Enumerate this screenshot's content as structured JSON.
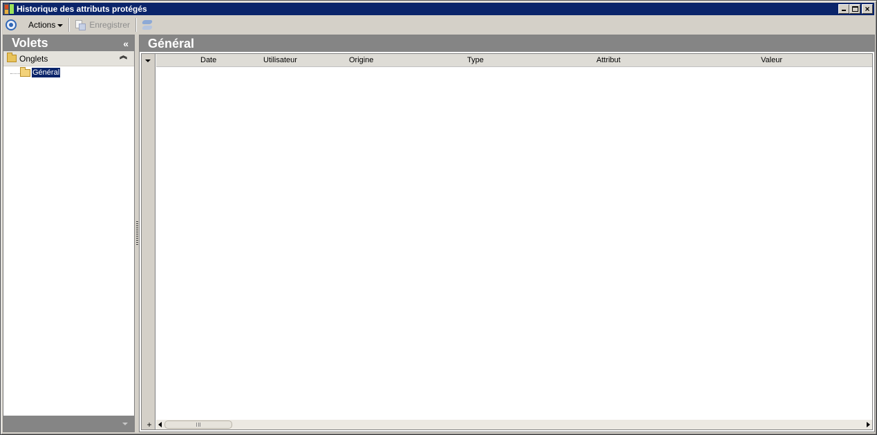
{
  "window": {
    "title": "Historique des attributs protégés"
  },
  "toolbar": {
    "actions_label": "Actions",
    "save_label": "Enregistrer"
  },
  "left_panel": {
    "title": "Volets",
    "collapse_glyph": "«",
    "group": {
      "label": "Onglets",
      "collapse_glyph": "»",
      "items": [
        {
          "label": "Général",
          "selected": true
        }
      ]
    }
  },
  "right_panel": {
    "title": "Général",
    "grid": {
      "columns": [
        "Date",
        "Utilisateur",
        "Origine",
        "Type",
        "Attribut",
        "Valeur"
      ],
      "rows": [],
      "add_glyph": "+"
    }
  },
  "colors": {
    "title_bar": "#0a246a",
    "panel_header": "#858585",
    "selection": "#0a246a"
  }
}
